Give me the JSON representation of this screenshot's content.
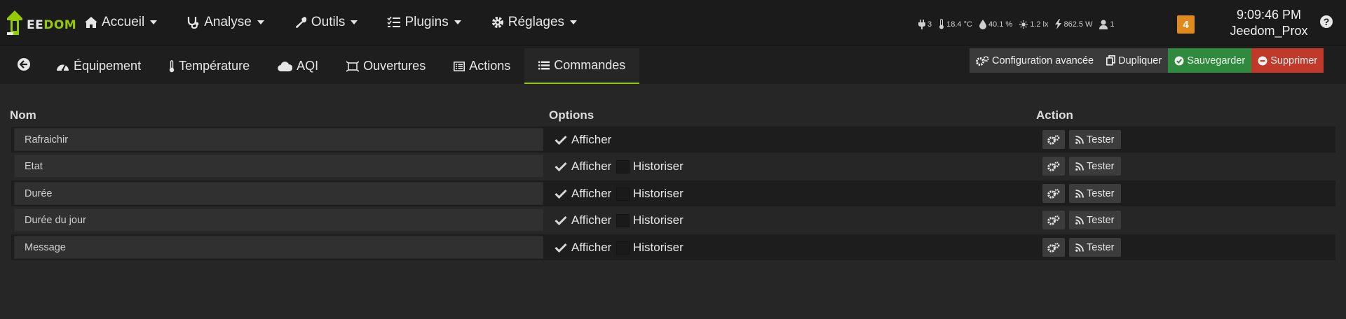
{
  "logo": {
    "text_part1": "EE",
    "text_part2": "DOM"
  },
  "nav": {
    "items": [
      {
        "label": "Accueil",
        "icon": "home-icon"
      },
      {
        "label": "Analyse",
        "icon": "stethoscope-icon"
      },
      {
        "label": "Outils",
        "icon": "wrench-icon"
      },
      {
        "label": "Plugins",
        "icon": "tasks-icon"
      },
      {
        "label": "Réglages",
        "icon": "gear-icon"
      }
    ]
  },
  "summary": {
    "outlets": "3",
    "temperature": "18.4 °C",
    "humidity": "40.1 %",
    "luminosity": "1.2 lx",
    "power": "862.5 W",
    "presence": "1"
  },
  "messages_badge": "4",
  "clock": {
    "time": "9:09:46 PM",
    "hostname": "Jeedom_Prox"
  },
  "help_label": "?",
  "tabs": [
    {
      "label": "Équipement",
      "icon": "tachometer-icon"
    },
    {
      "label": "Température",
      "icon": "thermometer-icon"
    },
    {
      "label": "AQI",
      "icon": "cloud-icon"
    },
    {
      "label": "Ouvertures",
      "icon": "window-icon"
    },
    {
      "label": "Actions",
      "icon": "list-alt-icon"
    },
    {
      "label": "Commandes",
      "icon": "list-icon",
      "active": true
    }
  ],
  "toolbar": {
    "config_label": "Configuration avancée",
    "dup_label": "Dupliquer",
    "save_label": "Sauvegarder",
    "delete_label": "Supprimer"
  },
  "table": {
    "headers": {
      "name": "Nom",
      "options": "Options",
      "action": "Action"
    },
    "afficher_label": "Afficher",
    "historiser_label": "Historiser",
    "test_label": "Tester",
    "rows": [
      {
        "name": "Rafraichir",
        "afficher": true,
        "has_historiser": false
      },
      {
        "name": "Etat",
        "afficher": true,
        "has_historiser": true,
        "historiser": false
      },
      {
        "name": "Durée",
        "afficher": true,
        "has_historiser": true,
        "historiser": false
      },
      {
        "name": "Durée du jour",
        "afficher": true,
        "has_historiser": true,
        "historiser": false
      },
      {
        "name": "Message",
        "afficher": true,
        "has_historiser": true,
        "historiser": false
      }
    ]
  },
  "colors": {
    "accent": "#94ca02",
    "save": "#2f8a3d",
    "delete": "#c0392b",
    "badge": "#e08a1e"
  }
}
